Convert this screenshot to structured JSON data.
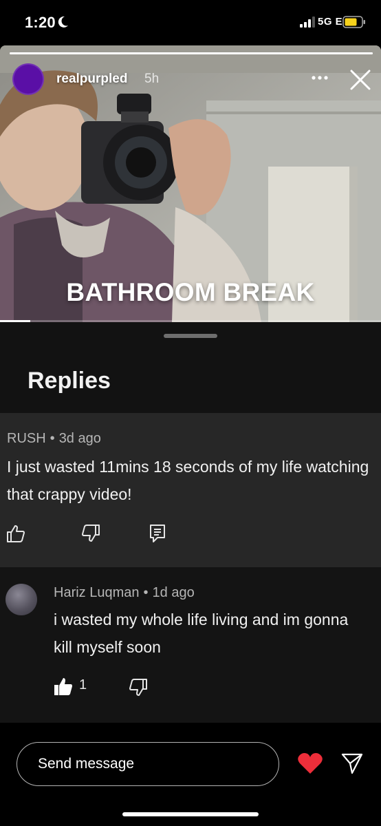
{
  "status_bar": {
    "time": "1:20",
    "network": "5G E",
    "icons": [
      "moon-icon",
      "signal-icon",
      "battery-icon"
    ],
    "battery_color": "#f7d21c"
  },
  "story": {
    "username": "realpurpled",
    "time_ago": "5h",
    "caption": "BATHROOM BREAK",
    "avatar_color": "#5a0fa6",
    "story_progress": 1.0,
    "video_progress": 0.08,
    "icons": [
      "more-icon",
      "close-icon"
    ]
  },
  "replies_sheet": {
    "title": "Replies",
    "comment": {
      "author": "RUSH",
      "separator": "•",
      "time_ago": "3d ago",
      "text": "I just wasted 11mins 18 seconds of my life watching that crappy video!",
      "icons": [
        "thumbs-up-icon",
        "thumbs-down-icon",
        "reply-icon"
      ]
    },
    "reply": {
      "author": "Hariz Luqman",
      "separator": "•",
      "time_ago": "1d ago",
      "text": "i wasted my whole life living and im gonna kill myself soon",
      "likes": "1",
      "icons": [
        "thumbs-up-filled-icon",
        "thumbs-down-icon"
      ]
    }
  },
  "message_bar": {
    "placeholder": "Send message",
    "heart_color": "#ed2e3a",
    "icons": [
      "heart-icon",
      "send-icon"
    ]
  }
}
